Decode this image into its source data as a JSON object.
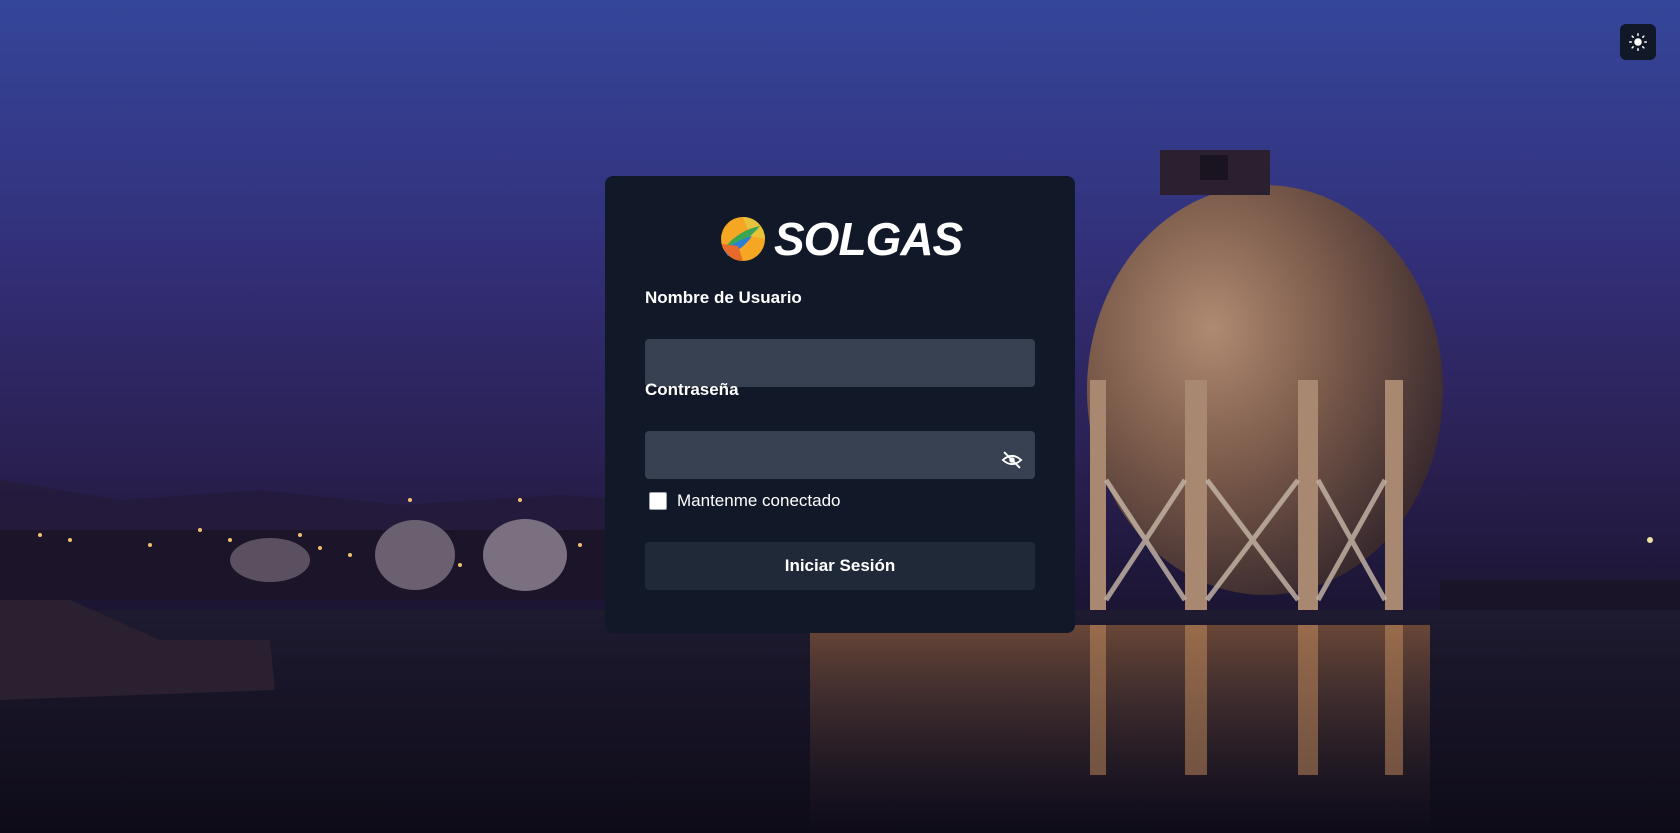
{
  "brand": {
    "name": "SOLGAS",
    "logo_icon": "solgas-logo-icon"
  },
  "header": {
    "theme_toggle_icon": "sun-icon"
  },
  "login_form": {
    "username_label": "Nombre de Usuario",
    "username_value": "",
    "password_label": "Contraseña",
    "password_value": "",
    "password_toggle_icon": "eye-off-icon",
    "remember_label": "Mantenme conectado",
    "remember_checked": false,
    "submit_label": "Iniciar Sesión"
  },
  "colors": {
    "card_bg": "#111827",
    "input_bg": "#374151",
    "button_bg": "#1f2937",
    "text": "#ffffff"
  }
}
